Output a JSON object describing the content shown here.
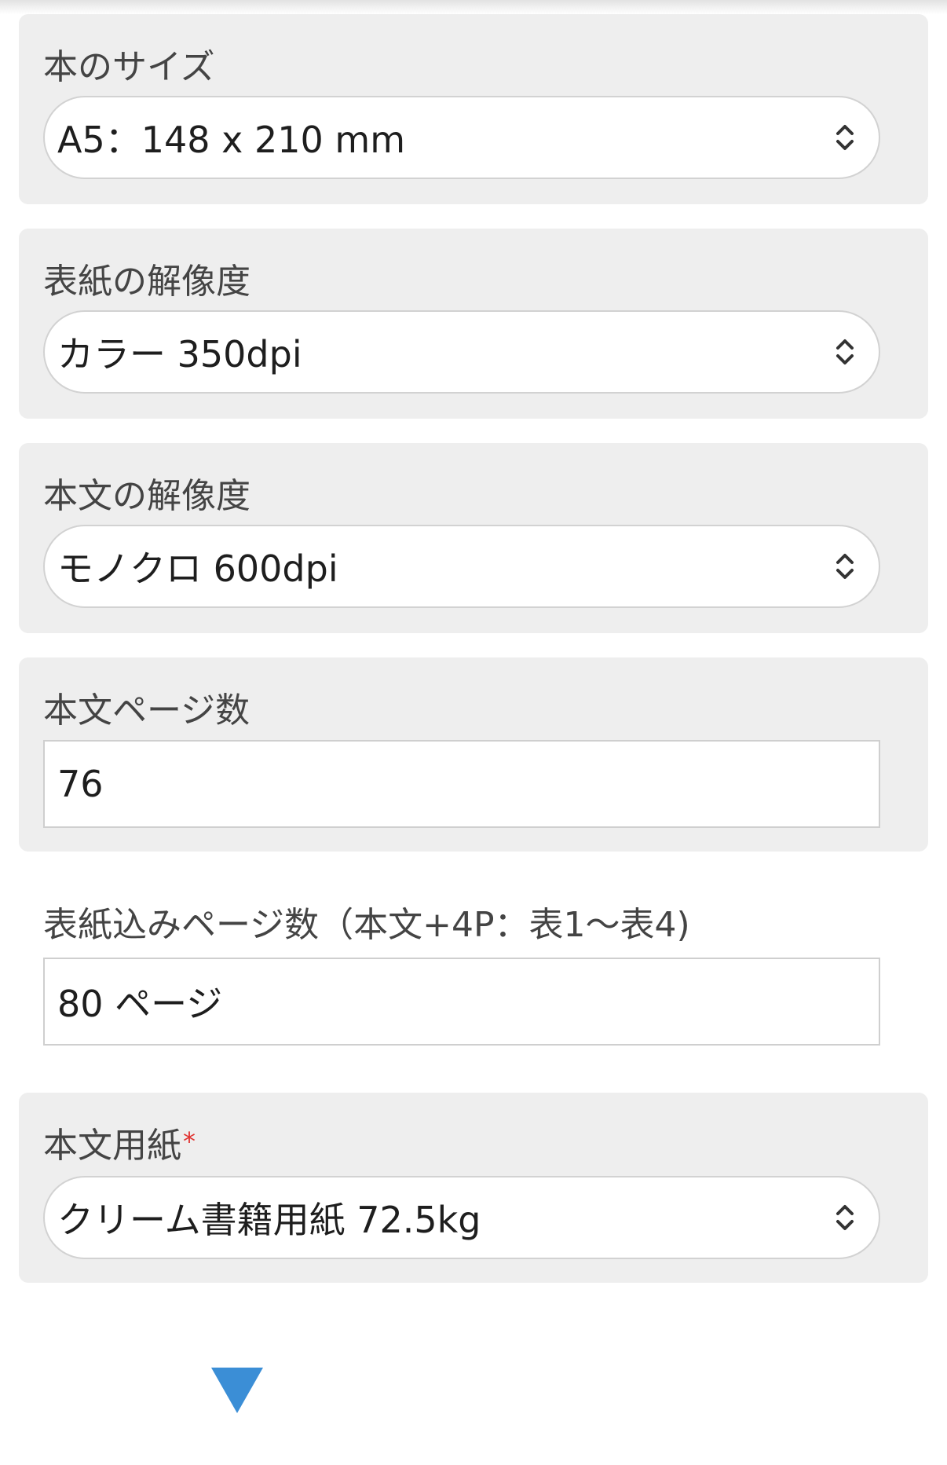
{
  "form": {
    "book_size": {
      "label": "本のサイズ",
      "value": "A5：148 x 210 mm"
    },
    "cover_resolution": {
      "label": "表紙の解像度",
      "value": "カラー 350dpi"
    },
    "body_resolution": {
      "label": "本文の解像度",
      "value": "モノクロ 600dpi"
    },
    "body_pages": {
      "label": "本文ページ数",
      "value": "76"
    },
    "total_pages": {
      "label": "表紙込みページ数（本文+4P：表1〜表4)",
      "value": "80 ページ"
    },
    "body_paper": {
      "label": "本文用紙",
      "required_mark": "*",
      "value": "クリーム書籍用紙 72.5kg"
    }
  },
  "icons": {
    "select_chevrons": "chevron-up-down-icon",
    "scroll_arrow": "triangle-down-icon"
  },
  "colors": {
    "card_bg": "#eeeeee",
    "accent": "#3b8ed6",
    "required": "#e0312f"
  }
}
